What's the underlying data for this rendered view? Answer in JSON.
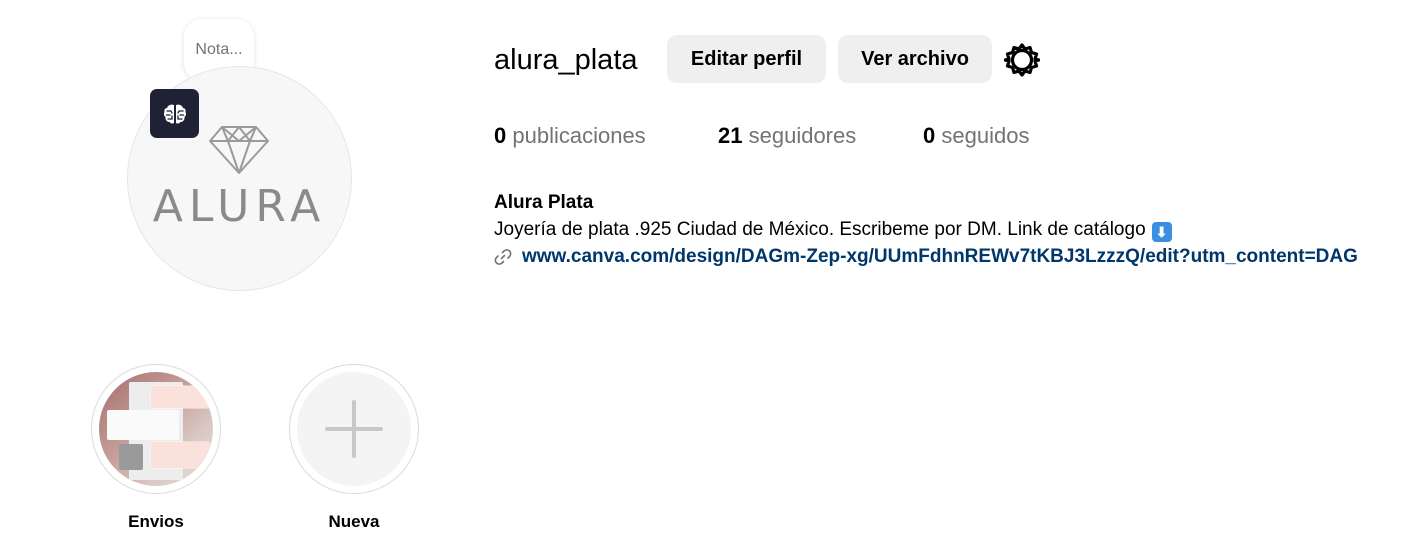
{
  "profile": {
    "username": "alura_plata",
    "avatar_brand": "ALURA",
    "note_placeholder": "Nota...",
    "badge_icon": "brain-icon"
  },
  "actions": {
    "edit_profile_label": "Editar perfil",
    "view_archive_label": "Ver archivo",
    "settings_icon": "gear-icon"
  },
  "stats": {
    "posts": {
      "count": "0",
      "label": "publicaciones"
    },
    "followers": {
      "count": "21",
      "label": "seguidores"
    },
    "following": {
      "count": "0",
      "label": "seguidos"
    }
  },
  "bio": {
    "full_name": "Alura Plata",
    "text": "Joyería de plata .925 Ciudad de México. Escribeme por DM. Link de catálogo",
    "emoji": "⬇",
    "link": "www.canva.com/design/DAGm-Zep-xg/UUmFdhnREWv7tKBJ3LzzzQ/edit?utm_content=DAG",
    "link_icon": "link-icon"
  },
  "highlights": [
    {
      "label": "Envios",
      "icon": "highlight-cover"
    },
    {
      "label": "Nueva",
      "icon": "plus-icon"
    }
  ],
  "colors": {
    "link": "#00376b",
    "secondary_text": "#737373",
    "button_bg": "#efefef",
    "badge_bg": "#1f2235"
  }
}
